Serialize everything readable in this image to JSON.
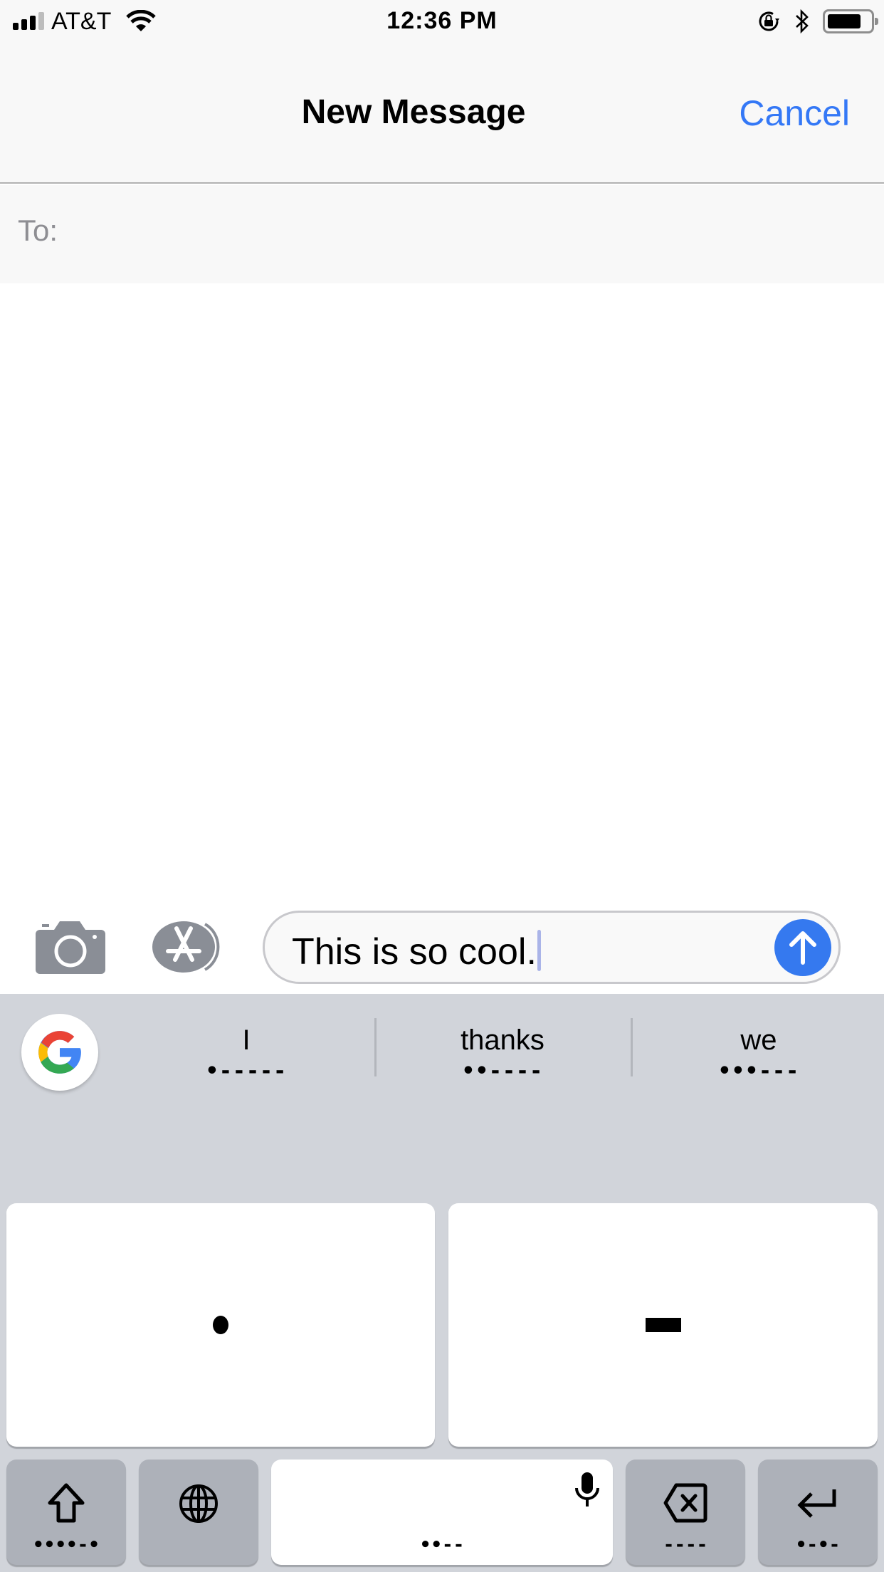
{
  "status_bar": {
    "carrier": "AT&T",
    "time": "12:36 PM",
    "signal_bars": 3,
    "signal_bars_total": 4,
    "battery_level_percent": 80,
    "icons": [
      "signal-icon",
      "wifi-icon",
      "rotation-lock-icon",
      "bluetooth-icon",
      "battery-icon"
    ]
  },
  "navbar": {
    "title": "New Message",
    "cancel_label": "Cancel",
    "accent_color": "#3478f6"
  },
  "recipient": {
    "label": "To:",
    "value": ""
  },
  "compose": {
    "message_text": "This is so cool.",
    "send_button_color": "#3579ef",
    "icons": [
      "camera-icon",
      "app-store-icon",
      "send-arrow-icon"
    ]
  },
  "keyboard": {
    "suggestions": [
      {
        "word": "I",
        "morse": "•-----"
      },
      {
        "word": "thanks",
        "morse": "••----"
      },
      {
        "word": "we",
        "morse": "•••---"
      }
    ],
    "dot_key_label": "dot",
    "dash_key_label": "dash",
    "bottom_keys": {
      "shift": {
        "icon": "shift-icon",
        "morse": "••••-•"
      },
      "globe": {
        "icon": "globe-icon",
        "morse": ""
      },
      "space": {
        "icon": "microphone-icon",
        "morse": "••--"
      },
      "backspace": {
        "icon": "backspace-icon",
        "morse": "----"
      },
      "return": {
        "icon": "return-icon",
        "morse": "•-•-"
      }
    }
  }
}
